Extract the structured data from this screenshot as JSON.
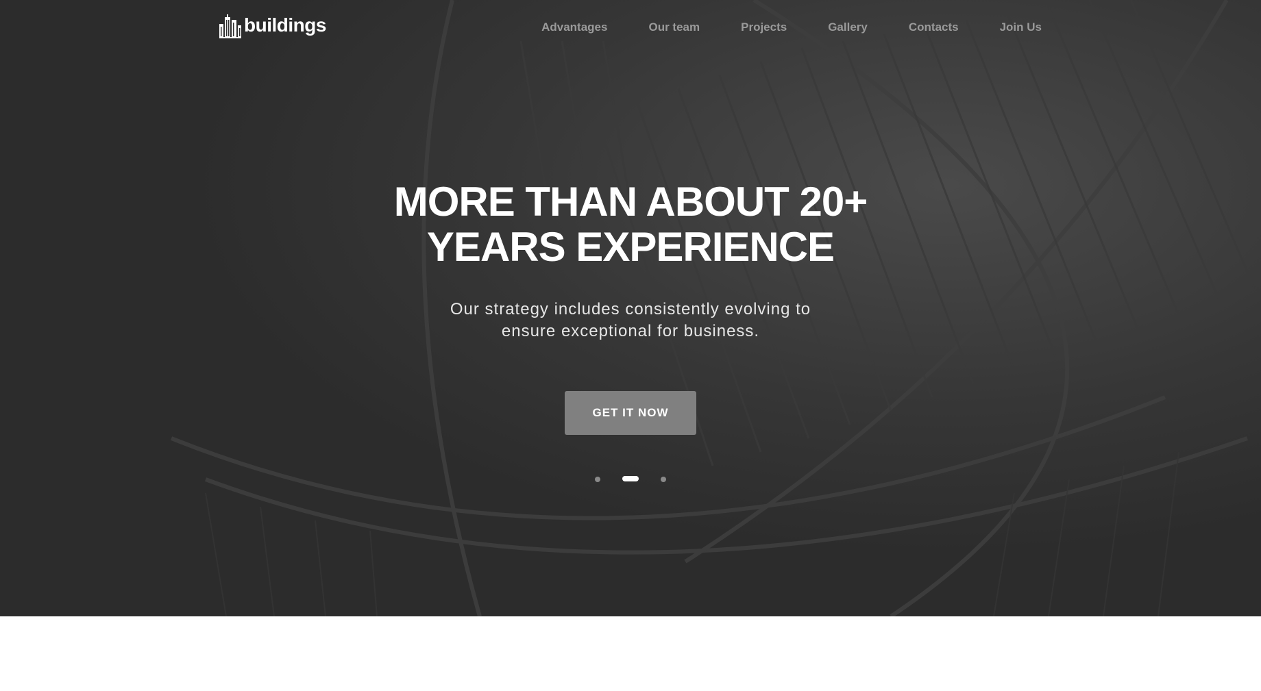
{
  "logo": {
    "text": "buildings",
    "icon": "building-icon"
  },
  "nav": {
    "items": [
      {
        "label": "Advantages"
      },
      {
        "label": "Our team"
      },
      {
        "label": "Projects"
      },
      {
        "label": "Gallery"
      },
      {
        "label": "Contacts"
      },
      {
        "label": "Join Us"
      }
    ]
  },
  "hero": {
    "title_line1": "MORE THAN ABOUT 20+",
    "title_line2": "YEARS EXPERIENCE",
    "subtitle_line1": "Our strategy includes consistently evolving to",
    "subtitle_line2": "ensure exceptional for business.",
    "cta_label": "GET IT NOW",
    "slider": {
      "count": 3,
      "active_index": 1
    }
  },
  "colors": {
    "hero_bg": "#2f2f2f",
    "nav_text": "#9a9a9a",
    "button_bg": "#808080",
    "text_white": "#ffffff"
  }
}
